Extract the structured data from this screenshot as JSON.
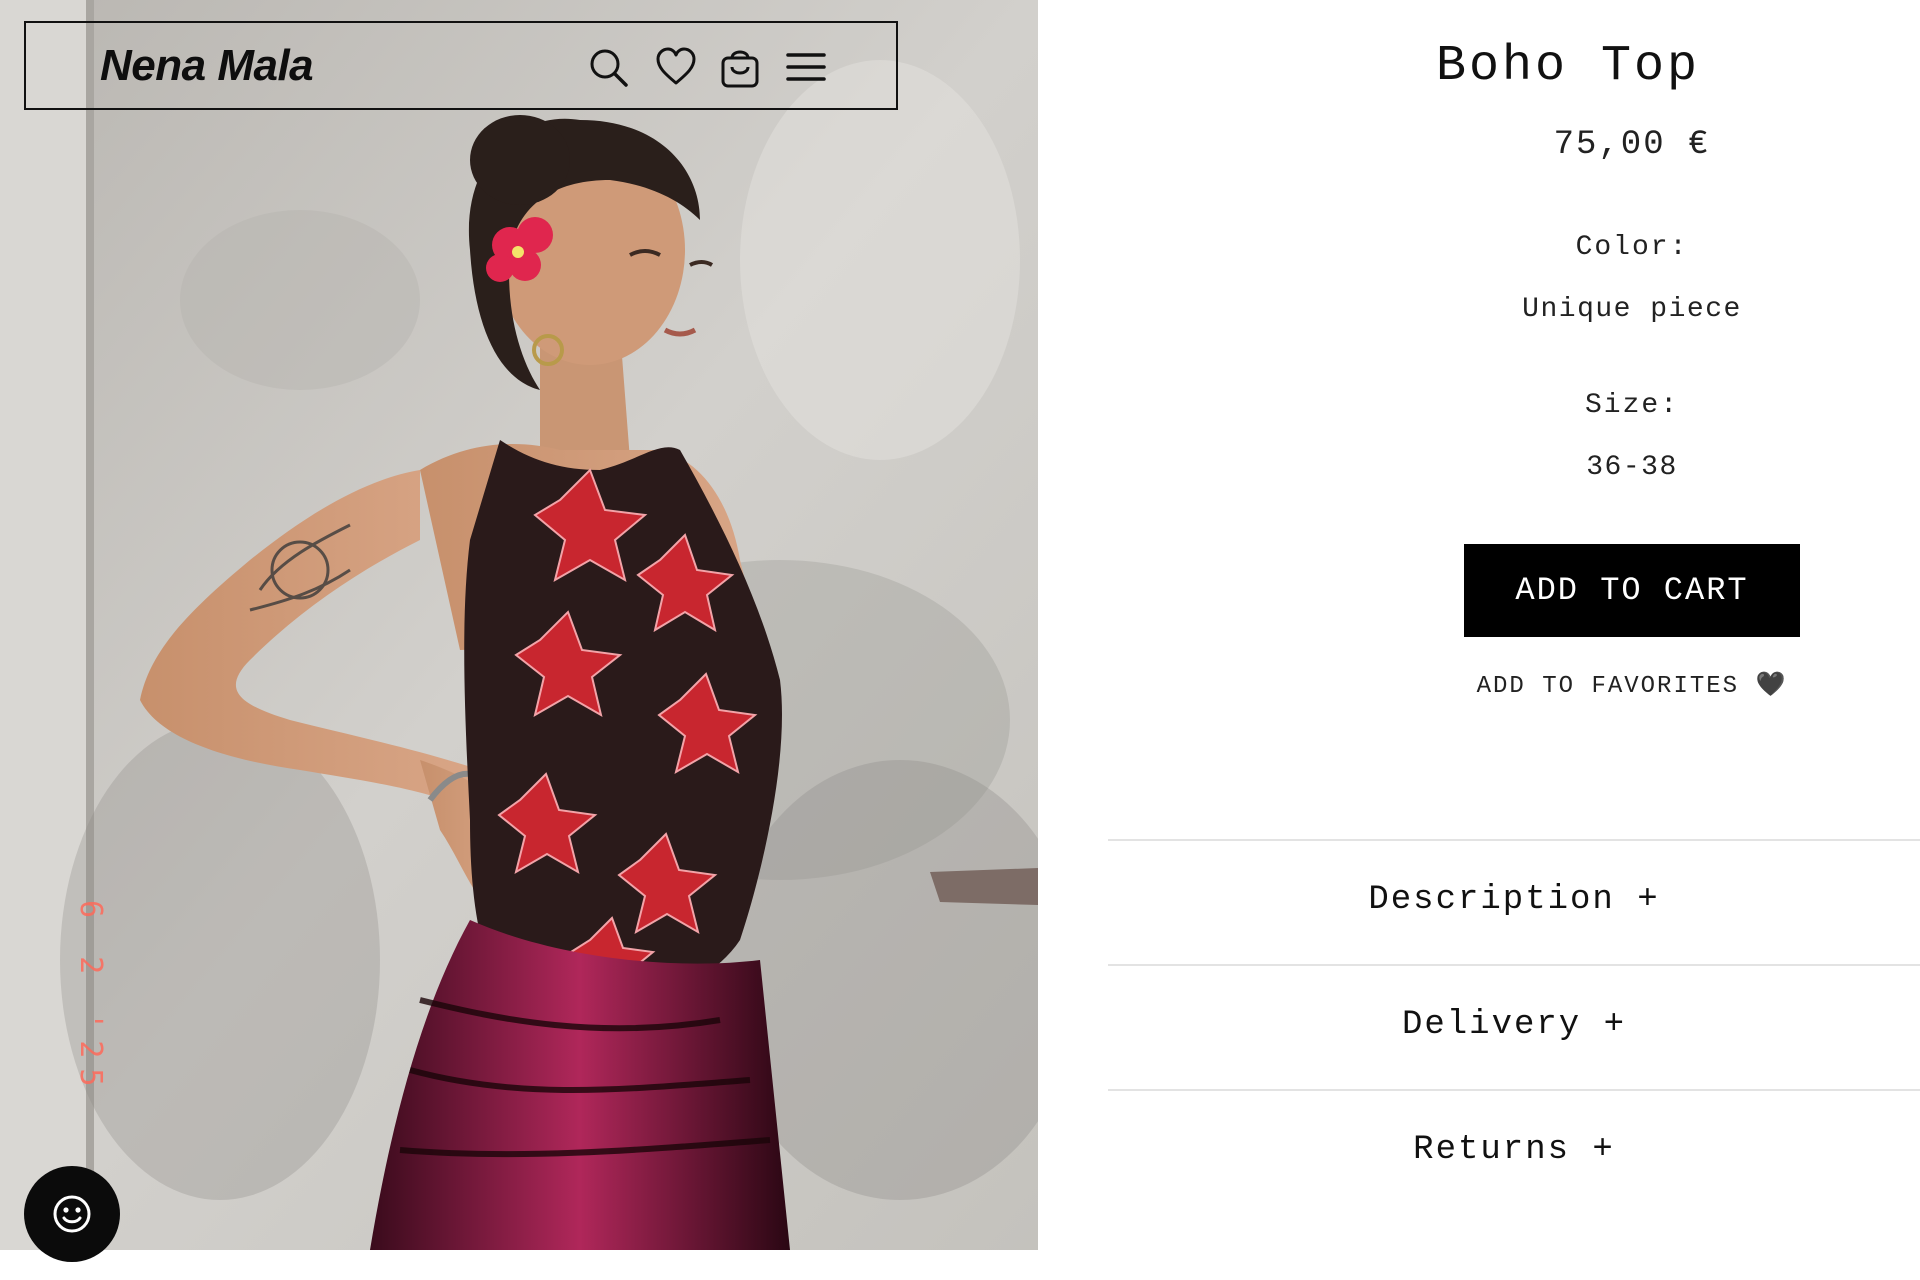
{
  "header": {
    "brand": "Nena Mala",
    "icons": [
      "search-icon",
      "heart-icon",
      "shopping-bag-icon",
      "menu-icon"
    ]
  },
  "photo": {
    "date_stamp": "6 2 '25"
  },
  "product": {
    "title": "Boho Top",
    "price": "75,00 €",
    "color_label": "Color:",
    "color_value": "Unique piece",
    "size_label": "Size:",
    "size_value": "36-38",
    "add_to_cart_label": "ADD TO CART",
    "add_to_favorites_label": "ADD TO FAVORITES",
    "favorites_heart": "🖤"
  },
  "accordion": [
    {
      "label": "Description +"
    },
    {
      "label": "Delivery +"
    },
    {
      "label": "Returns +"
    }
  ],
  "chat": {
    "icon": "smiley-icon"
  },
  "colors": {
    "button_bg": "#000000",
    "button_text": "#ffffff",
    "divider": "#e3e3e3",
    "text": "#111111",
    "date_stamp": "#ff6a5a"
  }
}
